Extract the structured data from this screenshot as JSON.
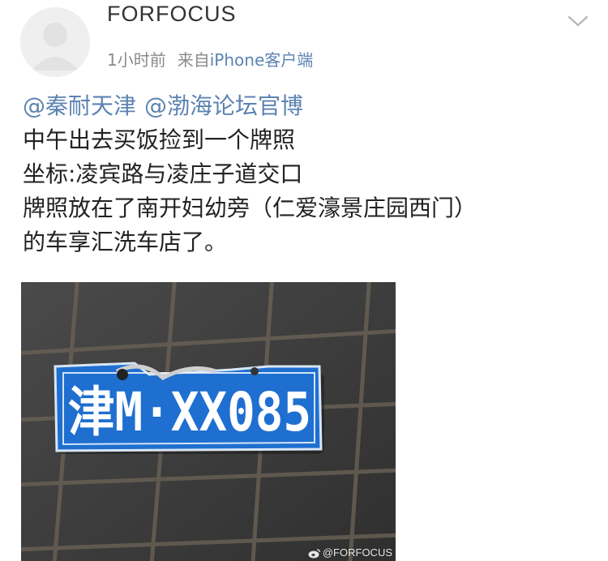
{
  "header": {
    "username": "FORFOCUS",
    "time": "1小时前",
    "source_label": "来自",
    "source_app": "iPhone客户端",
    "menu_icon": "chevron-down-icon"
  },
  "post": {
    "mentions": [
      "@秦耐天津",
      "@渤海论坛官博"
    ],
    "lines": [
      "中午出去买饭捡到一个牌照",
      "坐标:凌宾路与凌庄子道交口",
      "牌照放在了南开妇幼旁（仁爱濠景庄园西门）",
      "的车享汇洗车店了。"
    ]
  },
  "photo": {
    "plate_text": "津M·XX085",
    "watermark": "@FORFOCUS",
    "watermark_icon": "weibo-logo-icon"
  },
  "colors": {
    "link": "#5b83b1",
    "meta": "#8a8a8a",
    "plate_blue": "#1f6fd0"
  }
}
